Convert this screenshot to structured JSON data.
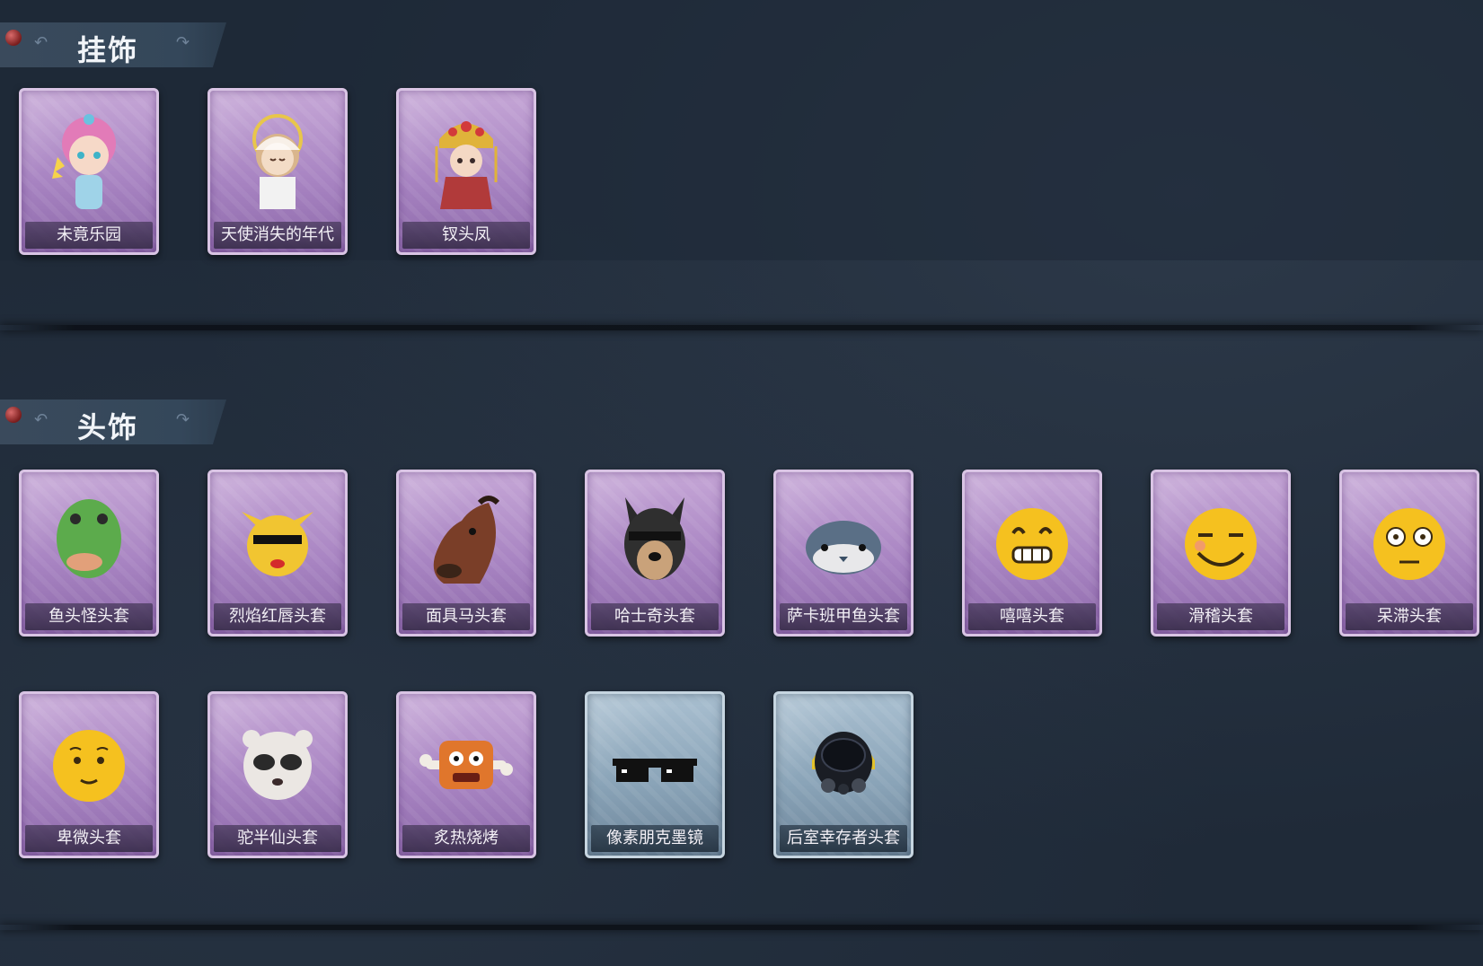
{
  "sections": [
    {
      "title": "挂饰",
      "items": [
        {
          "label": "未竟乐园",
          "icon": "fairy-doll-charm-icon"
        },
        {
          "label": "天使消失的年代",
          "icon": "angel-doll-charm-icon"
        },
        {
          "label": "钗头凤",
          "icon": "phoenix-crown-doll-charm-icon"
        }
      ]
    },
    {
      "title": "头饰",
      "items": [
        {
          "label": "鱼头怪头套",
          "icon": "fish-head-mask-icon"
        },
        {
          "label": "烈焰红唇头套",
          "icon": "yellow-mouse-mask-icon"
        },
        {
          "label": "面具马头套",
          "icon": "horse-head-mask-icon"
        },
        {
          "label": "哈士奇头套",
          "icon": "husky-head-mask-icon"
        },
        {
          "label": "萨卡班甲鱼头套",
          "icon": "sacabambaspis-mask-icon"
        },
        {
          "label": "嘻嘻头套",
          "icon": "grinning-emoji-mask-icon"
        },
        {
          "label": "滑稽头套",
          "icon": "smirk-emoji-mask-icon"
        },
        {
          "label": "呆滞头套",
          "icon": "dazed-emoji-mask-icon"
        },
        {
          "label": "卑微头套",
          "icon": "humble-emoji-mask-icon"
        },
        {
          "label": "驼半仙头套",
          "icon": "alpaca-sunglasses-mask-icon"
        },
        {
          "label": "炙热烧烤",
          "icon": "bbq-meat-mask-icon"
        },
        {
          "label": "像素朋克墨镜",
          "icon": "pixel-sunglasses-icon"
        },
        {
          "label": "后室幸存者头套",
          "icon": "gas-mask-helmet-icon"
        }
      ]
    }
  ],
  "colors": {
    "background": "#1f2a38",
    "card_purple": "#a884c2",
    "card_blue": "#8aa4b8",
    "pin_red": "#a83232"
  }
}
